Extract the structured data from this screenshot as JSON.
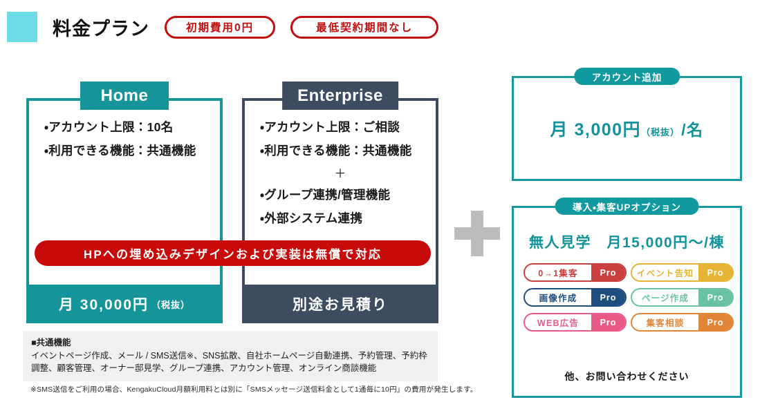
{
  "header": {
    "title": "料金プラン",
    "swatch_color": "#6ddce6",
    "badges": [
      {
        "label": "初期費用0円"
      },
      {
        "label": "最低契約期間なし"
      }
    ]
  },
  "plans": [
    {
      "id": "home",
      "name": "Home",
      "accent": "#15959a",
      "features": [
        "・アカウント上限：10名",
        "・利用できる機能：共通機能"
      ],
      "plus_separator": "",
      "price": "月 30,000円",
      "price_note": "（税抜）"
    },
    {
      "id": "enterprise",
      "name": "Enterprise",
      "accent": "#3d4c61",
      "features_top": [
        "・アカウント上限：ご相談",
        "・利用できる機能：共通機能"
      ],
      "plus_separator": "＋",
      "features_bottom": [
        "・グループ連携/管理機能",
        "・外部システム連携"
      ],
      "price": "別途お見積り",
      "price_note": ""
    }
  ],
  "ribbon": {
    "label": "HPへの埋め込みデザインおよび実装は無償で対応",
    "color": "#c70b0b"
  },
  "common_features": {
    "title": "■共通機能",
    "text": "イベントページ作成、メール / SMS送信※、SNS拡散、自社ホームページ自動連携、予約管理、予約枠調整、顧客管理、オーナー邸見学、グループ連携、アカウント管理、オンライン商談機能"
  },
  "disclaimer": "※SMS送信をご利用の場合、KengakuCloud月額利用料とは別に「SMSメッセージ送信料金として1通毎に10円」の費用が発生します。",
  "plus_sign": {
    "icon": "plus-icon",
    "color": "#bcbcbc"
  },
  "account_panel": {
    "tab_label": "アカウント追加",
    "price": "月 3,000円",
    "price_note": "（税抜）",
    "price_unit": "/名",
    "accent": "#12929a"
  },
  "option_panel": {
    "tab_label": "導入・集客UPオプション",
    "price_line": "無人見学　月15,000円〜/棟",
    "accent": "#12929a",
    "badges": [
      {
        "name": "0→1集客",
        "pro": "Pro",
        "color": "#c9403f"
      },
      {
        "name": "イベント告知",
        "pro": "Pro",
        "color": "#e6b435"
      },
      {
        "name": "画像作成",
        "pro": "Pro",
        "color": "#1d4e7e"
      },
      {
        "name": "ページ作成",
        "pro": "Pro",
        "color": "#69c2a4"
      },
      {
        "name": "WEB広告",
        "pro": "Pro",
        "color": "#e85a85"
      },
      {
        "name": "集客相談",
        "pro": "Pro",
        "color": "#e08536"
      }
    ],
    "footer": "他、お問い合わせください"
  }
}
